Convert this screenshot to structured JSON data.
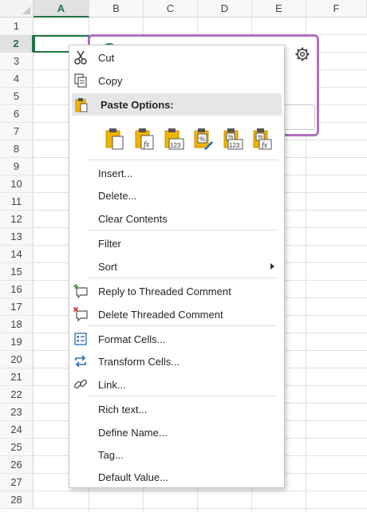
{
  "sheet": {
    "columns": [
      "A",
      "B",
      "C",
      "D",
      "E",
      "F"
    ],
    "rows": [
      "1",
      "2",
      "3",
      "4",
      "5",
      "6",
      "7",
      "8",
      "9",
      "10",
      "11",
      "12",
      "13",
      "14",
      "15",
      "16",
      "17",
      "18",
      "19",
      "20",
      "21",
      "22",
      "23",
      "24",
      "25",
      "26",
      "27",
      "28"
    ],
    "selected_column": "A",
    "selected_row": "2"
  },
  "context_menu": {
    "cut": "Cut",
    "copy": "Copy",
    "paste_options": "Paste Options:",
    "paste_icons": [
      "paste-icon",
      "paste-formulas-icon",
      "paste-values-icon",
      "paste-formatting-icon",
      "paste-values-format-icon",
      "paste-formulas-format-icon"
    ],
    "insert": "Insert...",
    "delete": "Delete...",
    "clear_contents": "Clear Contents",
    "filter": "Filter",
    "sort": "Sort",
    "reply_threaded_comment": "Reply to Threaded Comment",
    "delete_threaded_comment": "Delete Threaded Comment",
    "format_cells": "Format Cells...",
    "transform_cells": "Transform Cells...",
    "link": "Link...",
    "rich_text": "Rich text...",
    "define_name": "Define Name...",
    "tag": "Tag...",
    "default_value": "Default Value..."
  },
  "colors": {
    "accent": "#217346",
    "comment_border": "#b070c0",
    "clipboard": "#f0b400"
  }
}
